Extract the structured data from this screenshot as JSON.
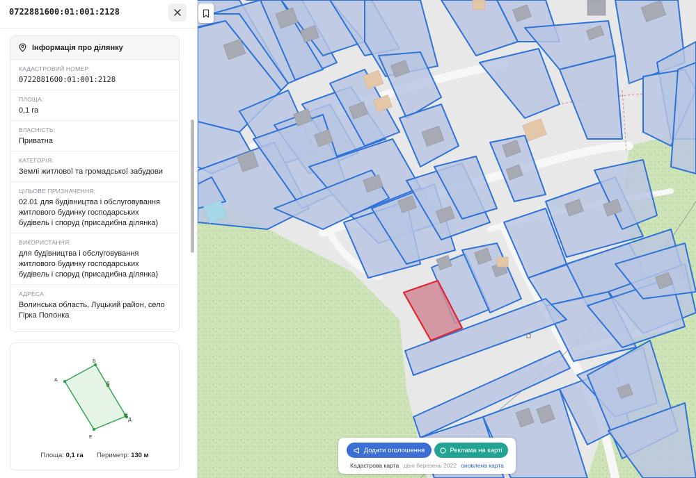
{
  "header": {
    "cadastral_number": "0722881600:01:001:2128"
  },
  "info": {
    "title": "Інформація про ділянку",
    "fields": [
      {
        "label": "КАДАСТРОВИЙ НОМЕР:",
        "value": "0722881600:01:001:2128"
      },
      {
        "label": "ПЛОЩА:",
        "value": "0,1 га"
      },
      {
        "label": "ВЛАСНІСТЬ:",
        "value": "Приватна"
      },
      {
        "label": "КАТЕГОРІЯ:",
        "value": "Землі житлової та громадської забудови"
      },
      {
        "label": "ЦІЛЬОВЕ ПРИЗНАЧЕННЯ:",
        "value": "02.01 для будівництва і обслуговування житлового будинку господарських будівель і споруд (присадибна ділянка)"
      },
      {
        "label": "ВИКОРИСТАННЯ:",
        "value": "для будівництва і обслуговування житлового будинку господарських будівель і споруд (присадибна ділянка)"
      },
      {
        "label": "АДРЕСА:",
        "value": "Волинська область, Луцький район, село Гірка Полонка"
      }
    ]
  },
  "shape": {
    "vertex_labels": [
      "А",
      "Б",
      "В",
      "Г",
      "Д",
      "Е"
    ],
    "area_label": "Площа:",
    "area_value": "0,1 га",
    "perimeter_label": "Периметр:",
    "perimeter_value": "130 м"
  },
  "map_bar": {
    "add_listing": "Додати оголошення",
    "ads_on_map": "Реклама на карті",
    "source": "Кадастрова карта",
    "date": "дані березень 2022",
    "updated": "оновлена карта"
  },
  "colors": {
    "parcel_fill": "#b8c6e3",
    "parcel_stroke": "#2f73d8",
    "selected_fill": "#cf8a98",
    "selected_stroke": "#e0242f",
    "forest": "#cfe3b8",
    "road": "#f5f5f5",
    "shape_stroke": "#2ea24a"
  },
  "icons": {
    "close": "close-icon",
    "pin": "location-pin-icon",
    "bookmark": "bookmark-icon",
    "megaphone": "megaphone-icon",
    "circle": "circle-icon"
  }
}
